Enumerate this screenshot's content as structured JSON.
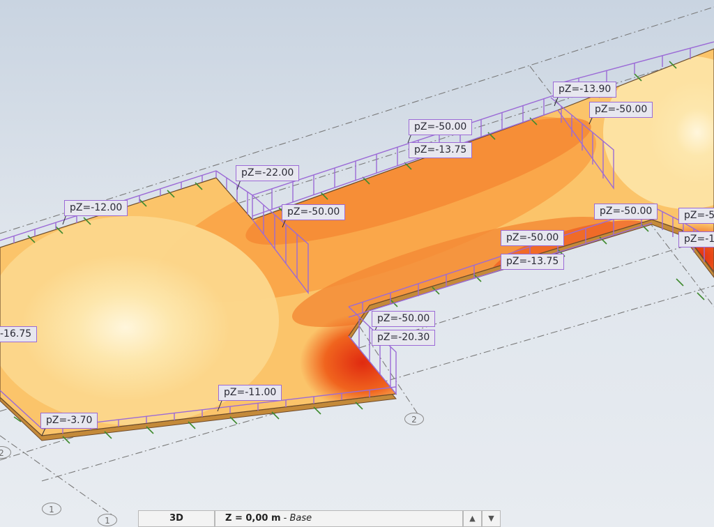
{
  "labels": [
    {
      "id": "l1",
      "text": "pZ=-13.90"
    },
    {
      "id": "l2",
      "text": "pZ=-50.00"
    },
    {
      "id": "l3",
      "text": "pZ=-50.00"
    },
    {
      "id": "l4",
      "text": "pZ=-13.75"
    },
    {
      "id": "l5",
      "text": "pZ=-22.00"
    },
    {
      "id": "l6",
      "text": "pZ=-12.00"
    },
    {
      "id": "l7",
      "text": "pZ=-50.00"
    },
    {
      "id": "l8",
      "text": "pZ=-50.00"
    },
    {
      "id": "l9",
      "text": "pZ=-50.00"
    },
    {
      "id": "l10",
      "text": "pZ=-13.75"
    },
    {
      "id": "l11",
      "text": "pZ=-5("
    },
    {
      "id": "l12",
      "text": "pZ=-1:"
    },
    {
      "id": "l13",
      "text": "-16.75"
    },
    {
      "id": "l14",
      "text": "pZ=-50.00"
    },
    {
      "id": "l15",
      "text": "pZ=-20.30"
    },
    {
      "id": "l16",
      "text": "pZ=-11.00"
    },
    {
      "id": "l17",
      "text": "pZ=-3.70"
    }
  ],
  "grid_bubbles": [
    {
      "id": "g1",
      "text": "2"
    },
    {
      "id": "g2",
      "text": "2"
    },
    {
      "id": "g3",
      "text": "1"
    },
    {
      "id": "g4",
      "text": "1"
    }
  ],
  "statusbar": {
    "view_mode": "3D",
    "plane_value": "Z = 0,00 m",
    "plane_separator": " - ",
    "plane_name": "Base",
    "up_arrow": "▲",
    "down_arrow": "▼"
  },
  "colors": {
    "background_top": "#c9d4e1",
    "slab_light": "#fdf0c8",
    "slab_mid": "#fbbf63",
    "slab_hot": "#e8401a",
    "load_line": "#9b6ad6",
    "support": "#3f8a2e",
    "grid_line": "#777777"
  }
}
